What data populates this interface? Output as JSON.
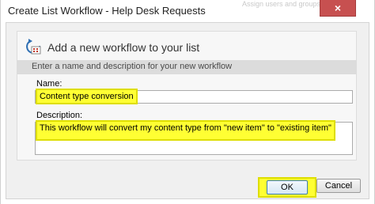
{
  "window": {
    "title": "Create List Workflow - Help Desk Requests",
    "close_glyph": "×",
    "background_hint": "Assign users and groups"
  },
  "header": {
    "title": "Add a new workflow to your list",
    "icon": "workflow-icon"
  },
  "section": {
    "label": "Enter a name and description for your new workflow"
  },
  "name": {
    "label": "Name:",
    "value": "Content type conversion"
  },
  "description": {
    "label": "Description:",
    "value": "This workflow will convert my content type from \"new item\" to \"existing item\""
  },
  "buttons": {
    "ok": "OK",
    "cancel": "Cancel"
  },
  "colors": {
    "highlight": "#ffff33",
    "close": "#c75050"
  }
}
